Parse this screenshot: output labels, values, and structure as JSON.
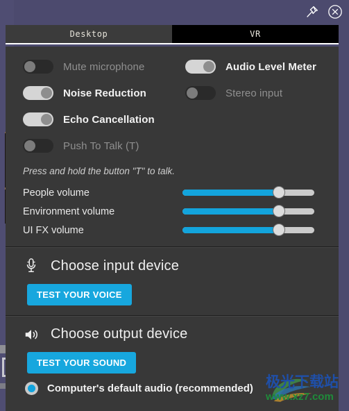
{
  "window": {
    "pin_icon": "pin-icon",
    "close_icon": "close-icon"
  },
  "tabs": [
    {
      "label": "Desktop",
      "active": true
    },
    {
      "label": "VR",
      "active": false
    }
  ],
  "audio_settings": {
    "toggles_left": [
      {
        "label": "Mute microphone",
        "state": "off"
      },
      {
        "label": "Noise Reduction",
        "state": "on"
      },
      {
        "label": "Echo Cancellation",
        "state": "on"
      },
      {
        "label": "Push To Talk (T)",
        "state": "off"
      }
    ],
    "toggles_right": [
      {
        "label": "Audio Level Meter",
        "state": "on"
      },
      {
        "label": "Stereo input",
        "state": "off"
      }
    ],
    "hint": "Press and hold the button \"T\" to talk.",
    "sliders": [
      {
        "label": "People volume",
        "value": 73
      },
      {
        "label": "Environment volume",
        "value": 73
      },
      {
        "label": "UI FX volume",
        "value": 73
      }
    ]
  },
  "input_device": {
    "icon": "microphone-icon",
    "title": "Choose input device",
    "test_button": "TEST YOUR VOICE"
  },
  "output_device": {
    "icon": "speaker-icon",
    "title": "Choose output device",
    "test_button": "TEST YOUR SOUND",
    "options": [
      {
        "label": "Computer's default audio (recommended)",
        "selected": true
      }
    ]
  },
  "watermark": {
    "chinese": "极光下载站",
    "url": "www.xz7.com"
  },
  "colors": {
    "accent_blue": "#13a4dc",
    "panel_bg": "#383838",
    "window_bg": "#4c4a6e",
    "tab_active_bg": "#3b3b3b",
    "tab_inactive_bg": "#000000"
  }
}
